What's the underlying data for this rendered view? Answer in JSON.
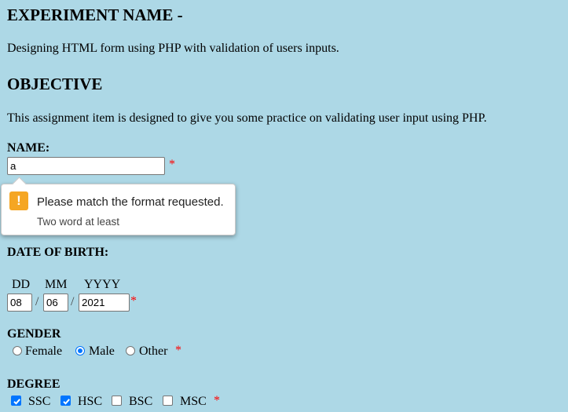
{
  "experiment": {
    "heading": "EXPERIMENT NAME -",
    "text": "Designing HTML form using PHP with validation of users inputs."
  },
  "objective": {
    "heading": "OBJECTIVE",
    "text": "This assignment item is designed to give you some practice on validating user input using PHP."
  },
  "name_field": {
    "label": "NAME:",
    "value": "a",
    "required_mark": "*"
  },
  "validation_tooltip": {
    "icon": "warning-icon",
    "message": "Please match the format requested.",
    "detail": "Two word at least"
  },
  "dob": {
    "label": "DATE OF BIRTH:",
    "headers": {
      "day": "DD",
      "month": "MM",
      "year": "YYYY"
    },
    "day": "08",
    "month": "06",
    "year": "2021",
    "separator": "/",
    "required_mark": "*"
  },
  "gender": {
    "label": "GENDER",
    "options": [
      {
        "label": "Female",
        "checked": false
      },
      {
        "label": "Male",
        "checked": true
      },
      {
        "label": "Other",
        "checked": false
      }
    ],
    "required_mark": "*"
  },
  "degree": {
    "label": "DEGREE",
    "options": [
      {
        "label": "SSC",
        "checked": true
      },
      {
        "label": "HSC",
        "checked": true
      },
      {
        "label": "BSC",
        "checked": false
      },
      {
        "label": "MSC",
        "checked": false
      }
    ],
    "required_mark": "*"
  },
  "colors": {
    "background": "#add8e6",
    "required": "#ff0000",
    "accent": "#0075ff",
    "warning": "#f5a623"
  }
}
